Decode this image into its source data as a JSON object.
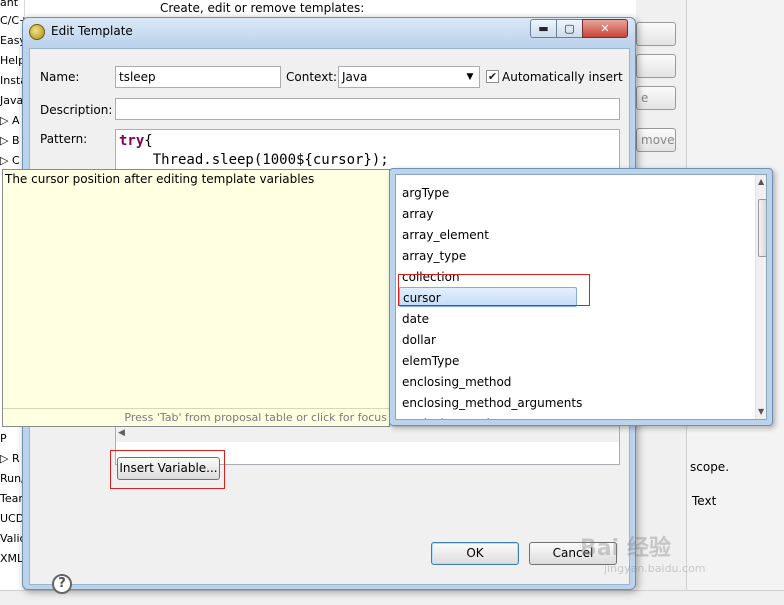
{
  "background": {
    "header_text": "Create, edit or remove templates:",
    "tree_items": [
      "ant",
      "C/C++",
      "Easy",
      "Help",
      "Insta",
      "Java",
      "▷ A",
      "▷ B",
      "▷ C",
      "P",
      "▷ R",
      "Run/",
      "Tear",
      "UCD",
      "Valid",
      "XML"
    ],
    "side_buttons": [
      "",
      "",
      "e",
      "moved",
      ""
    ],
    "scope_text": "scope.",
    "text_label": "Text"
  },
  "dialog": {
    "title": "Edit Template",
    "win_min": "▬",
    "win_max": "▢",
    "win_close": "✕",
    "name_label": "Name:",
    "name_value": "tsleep",
    "context_label": "Context:",
    "context_value": "Java",
    "auto_insert_label": "Automatically insert",
    "auto_insert_checked": "✔",
    "description_label": "Description:",
    "description_value": "",
    "pattern_label": "Pattern:",
    "pattern_lines": {
      "line1_kw": "try",
      "line1_rest": "{",
      "line2": "    Thread.sleep(1000${cursor});"
    },
    "insert_variable_button": "Insert Variable...",
    "ok_button": "OK",
    "cancel_button": "Cancel",
    "help_icon": "?"
  },
  "info_popup": {
    "text": "The cursor position after editing template variables",
    "hint": "Press 'Tab' from proposal table or click for focus"
  },
  "proposals": {
    "items": [
      "argType",
      "array",
      "array_element",
      "array_type",
      "collection",
      "cursor",
      "date",
      "dollar",
      "elemType",
      "enclosing_method",
      "enclosing_method_arguments",
      "enclosing_package"
    ],
    "selected": "cursor"
  },
  "watermark": {
    "main": "Bai 经验",
    "sub": "jingyan.baidu.com"
  },
  "colors": {
    "keyword": "#7f0055",
    "annotation": "#d9201e",
    "info_bg": "#ffffe1",
    "dialog_frame": "#bcd3ec"
  }
}
